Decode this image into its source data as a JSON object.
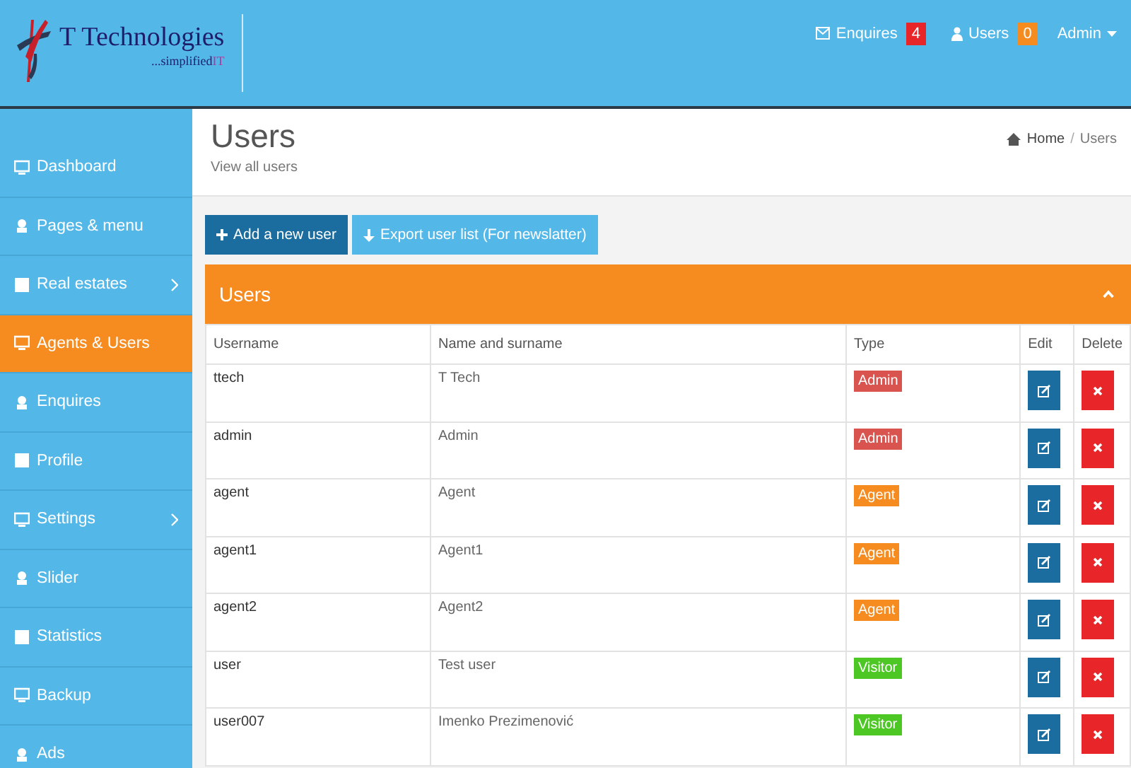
{
  "header": {
    "logo": {
      "name": "T Technologies",
      "tagline": "...simplified",
      "tagline_highlight": "IT"
    },
    "nav": [
      {
        "label": "Enquires",
        "count": "4",
        "color": "#e8262a"
      },
      {
        "label": "Users",
        "count": "0",
        "color": "#f68b1f"
      }
    ],
    "user_menu": "Admin"
  },
  "sidebar": {
    "items": [
      {
        "label": "Dashboard",
        "selected": false,
        "has_submenu": false
      },
      {
        "label": "Pages & menu",
        "selected": false,
        "has_submenu": false
      },
      {
        "label": "Real estates",
        "selected": false,
        "has_submenu": true
      },
      {
        "label": "Agents & Users",
        "selected": true,
        "has_submenu": false
      },
      {
        "label": "Enquires",
        "selected": false,
        "has_submenu": false
      },
      {
        "label": "Profile",
        "selected": false,
        "has_submenu": false
      },
      {
        "label": "Settings",
        "selected": false,
        "has_submenu": true
      },
      {
        "label": "Slider",
        "selected": false,
        "has_submenu": false
      },
      {
        "label": "Statistics",
        "selected": false,
        "has_submenu": false
      },
      {
        "label": "Backup",
        "selected": false,
        "has_submenu": false
      },
      {
        "label": "Ads",
        "selected": false,
        "has_submenu": false
      }
    ]
  },
  "page": {
    "title": "Users",
    "subtitle": "View all users",
    "breadcrumb": [
      "Home",
      "Users"
    ],
    "breadcrumb_separator": "/"
  },
  "buttons": [
    {
      "label": "Add a new user",
      "kind": "add"
    },
    {
      "label": "Export user list (For newslatter)",
      "kind": "export"
    }
  ],
  "panel": {
    "title": "Users",
    "expanded": true
  },
  "table": {
    "columns": [
      "Username",
      "Name and surname",
      "Type",
      "Edit",
      "Delete"
    ],
    "rows": [
      {
        "username": "ttech",
        "name": "T Tech",
        "type": "Admin",
        "color": "#d9534f"
      },
      {
        "username": "admin",
        "name": "Admin",
        "type": "Admin",
        "color": "#d9534f"
      },
      {
        "username": "agent",
        "name": "Agent",
        "type": "Agent",
        "color": "#f68b1f"
      },
      {
        "username": "agent1",
        "name": "Agent1",
        "type": "Agent",
        "color": "#f68b1f"
      },
      {
        "username": "agent2",
        "name": "Agent2",
        "type": "Agent",
        "color": "#f68b1f"
      },
      {
        "username": "user",
        "name": "Test user",
        "type": "Visitor",
        "color": "#4cc724"
      },
      {
        "username": "user007",
        "name": "Imenko Prezimenović",
        "type": "Visitor",
        "color": "#4cc724"
      }
    ]
  }
}
